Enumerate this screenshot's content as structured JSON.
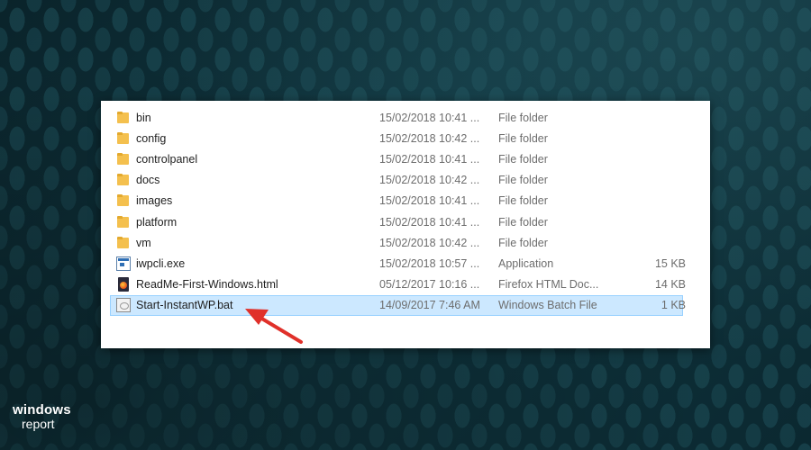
{
  "files": [
    {
      "name": "bin",
      "date": "15/02/2018 10:41 ...",
      "type": "File folder",
      "size": "",
      "icon": "folder-icon"
    },
    {
      "name": "config",
      "date": "15/02/2018 10:42 ...",
      "type": "File folder",
      "size": "",
      "icon": "folder-icon"
    },
    {
      "name": "controlpanel",
      "date": "15/02/2018 10:41 ...",
      "type": "File folder",
      "size": "",
      "icon": "folder-icon"
    },
    {
      "name": "docs",
      "date": "15/02/2018 10:42 ...",
      "type": "File folder",
      "size": "",
      "icon": "folder-icon"
    },
    {
      "name": "images",
      "date": "15/02/2018 10:41 ...",
      "type": "File folder",
      "size": "",
      "icon": "folder-icon"
    },
    {
      "name": "platform",
      "date": "15/02/2018 10:41 ...",
      "type": "File folder",
      "size": "",
      "icon": "folder-icon"
    },
    {
      "name": "vm",
      "date": "15/02/2018 10:42 ...",
      "type": "File folder",
      "size": "",
      "icon": "folder-icon"
    },
    {
      "name": "iwpcli.exe",
      "date": "15/02/2018 10:57 ...",
      "type": "Application",
      "size": "15 KB",
      "icon": "application-icon"
    },
    {
      "name": "ReadMe-First-Windows.html",
      "date": "05/12/2017 10:16 ...",
      "type": "Firefox HTML Doc...",
      "size": "14 KB",
      "icon": "firefox-document-icon"
    },
    {
      "name": "Start-InstantWP.bat",
      "date": "14/09/2017 7:46 AM",
      "type": "Windows Batch File",
      "size": "1 KB",
      "icon": "batch-file-icon",
      "selected": true
    }
  ],
  "brand": {
    "line1": "windows",
    "line2": "report"
  },
  "colors": {
    "selection_bg": "#cce8ff",
    "selection_border": "#99d1ff",
    "arrow": "#e0302a",
    "folder": "#f4c04e"
  }
}
